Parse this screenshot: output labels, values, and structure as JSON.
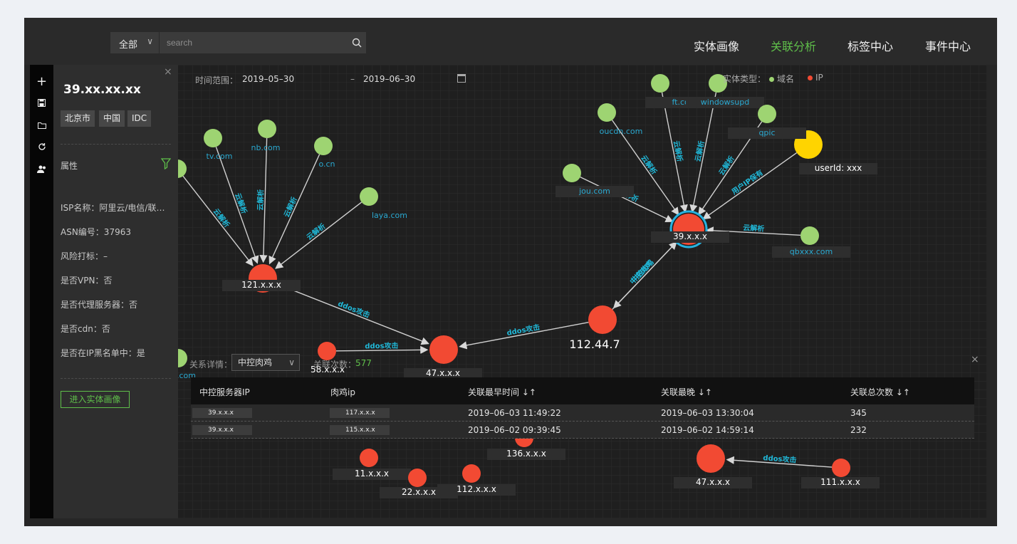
{
  "header": {
    "scope": "全部",
    "search_placeholder": "search",
    "nav": [
      "实体画像",
      "关联分析",
      "标签中心",
      "事件中心"
    ],
    "active_nav": "关联分析"
  },
  "toolbar": {
    "icons": [
      "plus-icon",
      "save-icon",
      "folder-icon",
      "refresh-icon",
      "users-icon"
    ]
  },
  "panel": {
    "title": "39.xx.xx.xx",
    "tags": [
      "北京市",
      "中国",
      "IDC"
    ],
    "attr_title": "属性",
    "attrs": [
      "ISP名称：阿里云/电信/联…",
      "ASN编号：37963",
      "风险打标：–",
      "是否VPN：否",
      "是否代理服务器：否",
      "是否cdn：否",
      "是否在IP黑名单中：是"
    ],
    "enter_button": "进入实体画像"
  },
  "filter": {
    "time_label": "时间范围：",
    "start": "2019–05–30",
    "sep": "–",
    "end": "2019–06–30",
    "type_label": "实体类型：",
    "legend_domain": "域名",
    "legend_ip": "IP"
  },
  "colors": {
    "domain": "#9ed472",
    "ip": "#f24a33",
    "user": "#ffd400",
    "edge_label": "#20b8d8",
    "accent": "#5fbf4a"
  },
  "graph": {
    "nodes": [
      {
        "label": "121.x.x.x",
        "type": "ip"
      },
      {
        "label": "47.x.x.x",
        "type": "ip"
      },
      {
        "label": "39.x.x.x",
        "type": "ip"
      },
      {
        "label": "112.44.7",
        "type": "ip"
      },
      {
        "label": "58.x.x.x",
        "type": "ip"
      },
      {
        "label": "11.x.x.x",
        "type": "ip"
      },
      {
        "label": "22.x.x.x",
        "type": "ip"
      },
      {
        "label": "112.x.x.x",
        "type": "ip"
      },
      {
        "label": "136.x.x.x",
        "type": "ip"
      },
      {
        "label": "47.x.x.x",
        "type": "ip"
      },
      {
        "label": "111.x.x.x",
        "type": "ip"
      },
      {
        "label": "userId: xxx",
        "type": "user"
      },
      {
        "label": "tv.com",
        "type": "domain"
      },
      {
        "label": "nb.com",
        "type": "domain"
      },
      {
        "label": "o.cn",
        "type": "domain"
      },
      {
        "label": "laya.com",
        "type": "domain"
      },
      {
        "label": "com",
        "type": "domain"
      },
      {
        "label": "ft.com",
        "type": "domain"
      },
      {
        "label": "windowsupd",
        "type": "domain"
      },
      {
        "label": "oucdn.com",
        "type": "domain"
      },
      {
        "label": "qpic",
        "type": "domain"
      },
      {
        "label": "jou.com",
        "type": "domain"
      },
      {
        "label": "qbxxx.com",
        "type": "domain"
      },
      {
        "label": "cn.com",
        "type": "domain"
      }
    ],
    "edge_labels": [
      "云解析",
      "ddos攻击",
      "中控肉鸡",
      "用户IP保有"
    ]
  },
  "bottom": {
    "relation_label": "关系详情：",
    "relation_value": "中控肉鸡",
    "count_label": "关联次数：",
    "count_value": "577",
    "columns": [
      "中控服务器IP",
      "肉鸡ip",
      "关联最早时间 ↓↑",
      "关联最晚 ↓↑",
      "关联总次数 ↓↑"
    ],
    "rows": [
      [
        "39.x.x.x",
        "117.x.x.x",
        "2019–06–03 11:49:22",
        "2019–06–03 13:30:04",
        "345"
      ],
      [
        "39.x.x.x",
        "115.x.x.x",
        "2019–06–02 09:39:45",
        "2019–06–02 14:59:14",
        "232"
      ]
    ]
  }
}
